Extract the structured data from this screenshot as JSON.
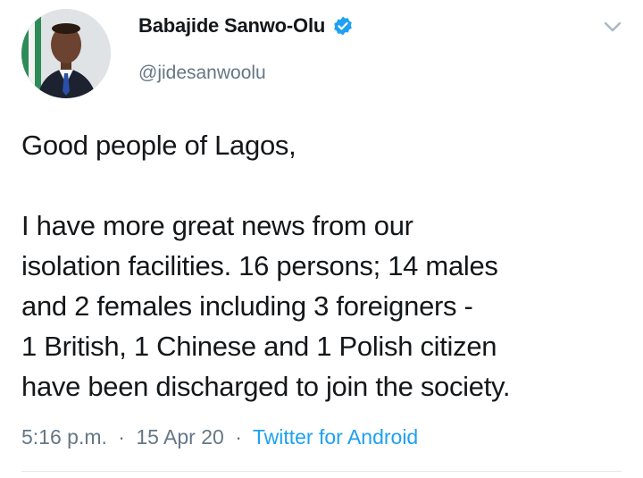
{
  "author": {
    "display_name": "Babajide Sanwo-Olu",
    "handle": "@jidesanwoolu",
    "verified": true,
    "avatar_icon": "profile-photo",
    "verified_color": "#1da1f2"
  },
  "menu": {
    "icon": "chevron-down-icon"
  },
  "tweet": {
    "greeting": "Good people of Lagos,",
    "lines": [
      "I have more great news from our",
      "isolation facilities. 16 persons; 14 males",
      "and 2 females including 3 foreigners -",
      "1 British, 1 Chinese and 1 Polish citizen",
      "have been discharged to join the society."
    ]
  },
  "meta": {
    "time": "5:16 p.m.",
    "separator": "·",
    "date": "15 Apr 20",
    "source": "Twitter for Android",
    "source_color": "#1da1f2"
  }
}
